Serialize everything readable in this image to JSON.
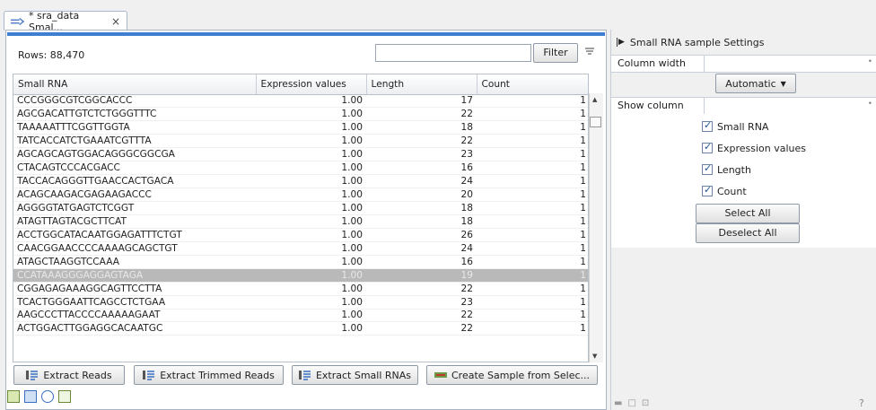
{
  "tab": {
    "title": "* sra_data Smal...",
    "close": "×"
  },
  "toolbar": {
    "rows_label": "Rows: 88,470",
    "filter_placeholder": "",
    "filter_button": "Filter"
  },
  "table": {
    "columns": [
      "Small RNA",
      "Expression values",
      "Length",
      "Count"
    ],
    "rows": [
      [
        "CCCGGGCGTCGGCACCC",
        "1.00",
        "17",
        "1"
      ],
      [
        "AGCGACATTGTCTCTGGGTTTC",
        "1.00",
        "22",
        "1"
      ],
      [
        "TAAAAATTTCGGTTGGTA",
        "1.00",
        "18",
        "1"
      ],
      [
        "TATCACCATCTGAAATCGTTTA",
        "1.00",
        "22",
        "1"
      ],
      [
        "AGCAGCAGTGGACAGGGCGGCGA",
        "1.00",
        "23",
        "1"
      ],
      [
        "CTACAGTCCCACGACC",
        "1.00",
        "16",
        "1"
      ],
      [
        "TACCACAGGGTTGAACCACTGACA",
        "1.00",
        "24",
        "1"
      ],
      [
        "ACAGCAAGACGAGAAGACCC",
        "1.00",
        "20",
        "1"
      ],
      [
        "AGGGGTATGAGTCTCGGT",
        "1.00",
        "18",
        "1"
      ],
      [
        "ATAGTTAGTACGCTTCAT",
        "1.00",
        "18",
        "1"
      ],
      [
        "ACCTGGCATACAATGGAGATTTCTGT",
        "1.00",
        "26",
        "1"
      ],
      [
        "CAACGGAACCCCAAAAGCAGCTGT",
        "1.00",
        "24",
        "1"
      ],
      [
        "ATAGCTAAGGTCCAAA",
        "1.00",
        "16",
        "1"
      ],
      [
        "CCATAAAGGGAGGAGTAGA",
        "1.00",
        "19",
        "1"
      ],
      [
        "CGGAGAGAAAGGCAGTTCCTTA",
        "1.00",
        "22",
        "1"
      ],
      [
        "TCACTGGGAATTCAGCCTCTGAA",
        "1.00",
        "23",
        "1"
      ],
      [
        "AAGCCCTTACCCCAAAAAGAAT",
        "1.00",
        "22",
        "1"
      ],
      [
        "ACTGGACTTGGAGGCACAATGC",
        "1.00",
        "22",
        "1"
      ]
    ],
    "selected_row_index": 13
  },
  "buttons": {
    "extract_reads": "Extract Reads",
    "extract_trimmed": "Extract Trimmed Reads",
    "extract_small_rnas": "Extract Small RNAs",
    "create_sample": "Create Sample from Selec..."
  },
  "settings": {
    "title": "Small RNA sample Settings",
    "column_width_label": "Column width",
    "column_width_value": "Automatic",
    "show_column_label": "Show column",
    "checkboxes": [
      "Small RNA",
      "Expression values",
      "Length",
      "Count"
    ],
    "select_all": "Select All",
    "deselect_all": "Deselect All",
    "help": "?"
  },
  "colors": {
    "accent": "#3f7fd1",
    "selected_row": "#b9b9b9"
  }
}
